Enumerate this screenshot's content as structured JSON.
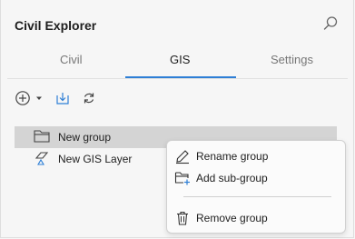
{
  "header": {
    "title": "Civil Explorer",
    "search_icon": "search-icon"
  },
  "tabs": [
    {
      "label": "Civil",
      "active": false
    },
    {
      "label": "GIS",
      "active": true
    },
    {
      "label": "Settings",
      "active": false
    }
  ],
  "toolbar": {
    "icons": [
      "add-circle-icon",
      "dropdown-caret-icon",
      "import-icon",
      "refresh-icon"
    ]
  },
  "tree": {
    "items": [
      {
        "label": "New group",
        "icon": "folder-icon",
        "selected": true
      },
      {
        "label": "New GIS Layer",
        "icon": "gis-layer-icon",
        "selected": false
      }
    ]
  },
  "context_menu": {
    "items": [
      {
        "label": "Rename group",
        "icon": "pencil-icon"
      },
      {
        "label": "Add sub-group",
        "icon": "add-folder-icon"
      },
      {
        "label": "Remove group",
        "icon": "trash-icon"
      }
    ]
  },
  "colors": {
    "accent": "#2e7fd6",
    "selected_row": "#d4d4d4",
    "background": "#f6f6f6"
  }
}
